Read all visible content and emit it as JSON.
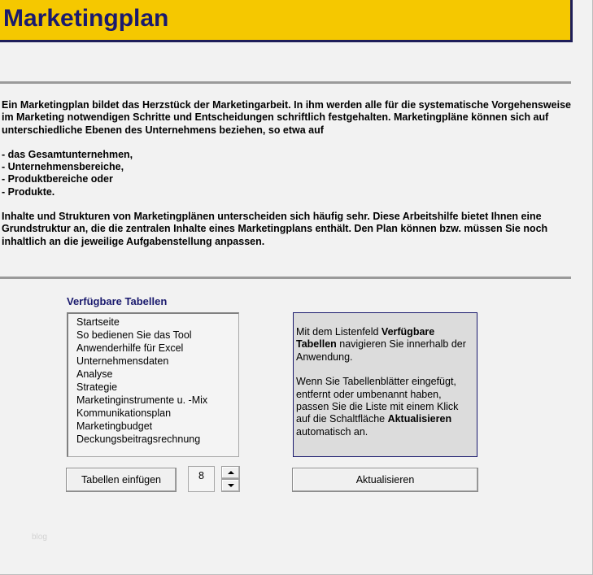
{
  "header": {
    "title": "Marketingplan"
  },
  "intro": {
    "p1": "Ein Marketingplan bildet das Herzstück der Marketingarbeit. In ihm werden alle für die systematische Vorgehensweise im Marketing notwendigen Schritte und Entscheidungen schriftlich festgehalten. Marketingpläne können sich auf unterschiedliche Ebenen des Unternehmens beziehen, so etwa auf",
    "bullets": [
      "- das Gesamtunternehmen,",
      "- Unternehmensbereiche,",
      "- Produktbereiche oder",
      "- Produkte."
    ],
    "p2": "Inhalte und Strukturen von Marketingplänen unterscheiden sich häufig sehr. Diese Arbeitshilfe bietet Ihnen eine Grundstruktur an, die die zentralen Inhalte eines Marketingplans enthält. Den Plan können bzw. müssen Sie noch inhaltlich an die jeweilige Aufgabenstellung anpassen."
  },
  "tables": {
    "heading": "Verfügbare Tabellen",
    "items": [
      "Startseite",
      "So bedienen Sie das Tool",
      "Anwenderhilfe für Excel",
      "Unternehmensdaten",
      "Analyse",
      "Strategie",
      "Marketinginstrumente u. -Mix",
      "Kommunikationsplan",
      "Marketingbudget",
      "Deckungsbeitragsrechnung"
    ]
  },
  "info": {
    "p1_pre": "Mit dem Listenfeld ",
    "p1_bold": "Verfügbare Tabellen",
    "p1_post": " navigieren Sie innerhalb der Anwendung.",
    "p2_pre": "Wenn Sie Tabellenblätter eingefügt, entfernt oder umbenannt haben, passen Sie die Liste mit einem Klick auf die Schaltfläche ",
    "p2_bold": "Aktualisieren",
    "p2_post": " automatisch an."
  },
  "controls": {
    "insert_label": "Tabellen einfügen",
    "count_value": "8",
    "refresh_label": "Aktualisieren"
  },
  "watermark": "blog",
  "colors": {
    "title_bar": "#f5c800",
    "title_text": "#1a1a6e",
    "separator": "#9a9a9a",
    "info_bg": "#dcdcdc"
  }
}
